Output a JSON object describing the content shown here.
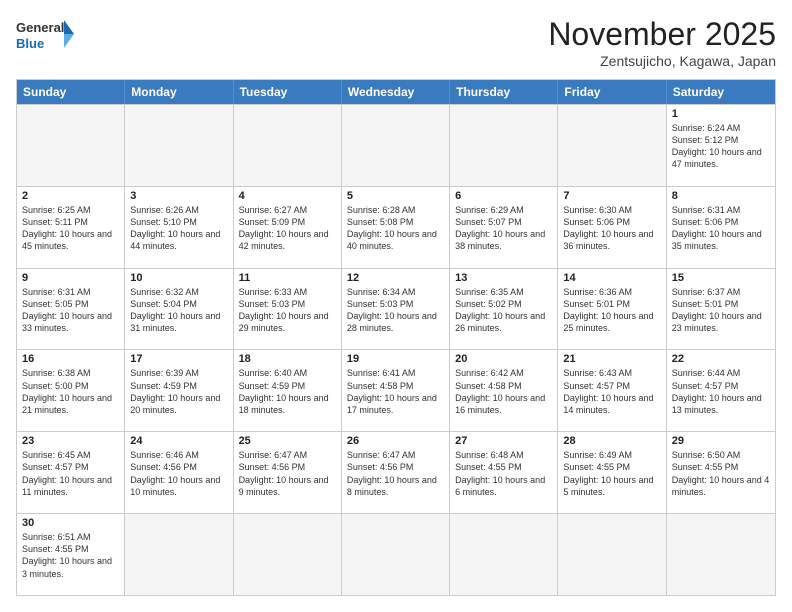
{
  "logo": {
    "line1": "General",
    "line2": "Blue"
  },
  "title": "November 2025",
  "location": "Zentsujicho, Kagawa, Japan",
  "weekdays": [
    "Sunday",
    "Monday",
    "Tuesday",
    "Wednesday",
    "Thursday",
    "Friday",
    "Saturday"
  ],
  "weeks": [
    [
      {
        "day": "",
        "info": ""
      },
      {
        "day": "",
        "info": ""
      },
      {
        "day": "",
        "info": ""
      },
      {
        "day": "",
        "info": ""
      },
      {
        "day": "",
        "info": ""
      },
      {
        "day": "",
        "info": ""
      },
      {
        "day": "1",
        "info": "Sunrise: 6:24 AM\nSunset: 5:12 PM\nDaylight: 10 hours and 47 minutes."
      }
    ],
    [
      {
        "day": "2",
        "info": "Sunrise: 6:25 AM\nSunset: 5:11 PM\nDaylight: 10 hours and 45 minutes."
      },
      {
        "day": "3",
        "info": "Sunrise: 6:26 AM\nSunset: 5:10 PM\nDaylight: 10 hours and 44 minutes."
      },
      {
        "day": "4",
        "info": "Sunrise: 6:27 AM\nSunset: 5:09 PM\nDaylight: 10 hours and 42 minutes."
      },
      {
        "day": "5",
        "info": "Sunrise: 6:28 AM\nSunset: 5:08 PM\nDaylight: 10 hours and 40 minutes."
      },
      {
        "day": "6",
        "info": "Sunrise: 6:29 AM\nSunset: 5:07 PM\nDaylight: 10 hours and 38 minutes."
      },
      {
        "day": "7",
        "info": "Sunrise: 6:30 AM\nSunset: 5:06 PM\nDaylight: 10 hours and 36 minutes."
      },
      {
        "day": "8",
        "info": "Sunrise: 6:31 AM\nSunset: 5:06 PM\nDaylight: 10 hours and 35 minutes."
      }
    ],
    [
      {
        "day": "9",
        "info": "Sunrise: 6:31 AM\nSunset: 5:05 PM\nDaylight: 10 hours and 33 minutes."
      },
      {
        "day": "10",
        "info": "Sunrise: 6:32 AM\nSunset: 5:04 PM\nDaylight: 10 hours and 31 minutes."
      },
      {
        "day": "11",
        "info": "Sunrise: 6:33 AM\nSunset: 5:03 PM\nDaylight: 10 hours and 29 minutes."
      },
      {
        "day": "12",
        "info": "Sunrise: 6:34 AM\nSunset: 5:03 PM\nDaylight: 10 hours and 28 minutes."
      },
      {
        "day": "13",
        "info": "Sunrise: 6:35 AM\nSunset: 5:02 PM\nDaylight: 10 hours and 26 minutes."
      },
      {
        "day": "14",
        "info": "Sunrise: 6:36 AM\nSunset: 5:01 PM\nDaylight: 10 hours and 25 minutes."
      },
      {
        "day": "15",
        "info": "Sunrise: 6:37 AM\nSunset: 5:01 PM\nDaylight: 10 hours and 23 minutes."
      }
    ],
    [
      {
        "day": "16",
        "info": "Sunrise: 6:38 AM\nSunset: 5:00 PM\nDaylight: 10 hours and 21 minutes."
      },
      {
        "day": "17",
        "info": "Sunrise: 6:39 AM\nSunset: 4:59 PM\nDaylight: 10 hours and 20 minutes."
      },
      {
        "day": "18",
        "info": "Sunrise: 6:40 AM\nSunset: 4:59 PM\nDaylight: 10 hours and 18 minutes."
      },
      {
        "day": "19",
        "info": "Sunrise: 6:41 AM\nSunset: 4:58 PM\nDaylight: 10 hours and 17 minutes."
      },
      {
        "day": "20",
        "info": "Sunrise: 6:42 AM\nSunset: 4:58 PM\nDaylight: 10 hours and 16 minutes."
      },
      {
        "day": "21",
        "info": "Sunrise: 6:43 AM\nSunset: 4:57 PM\nDaylight: 10 hours and 14 minutes."
      },
      {
        "day": "22",
        "info": "Sunrise: 6:44 AM\nSunset: 4:57 PM\nDaylight: 10 hours and 13 minutes."
      }
    ],
    [
      {
        "day": "23",
        "info": "Sunrise: 6:45 AM\nSunset: 4:57 PM\nDaylight: 10 hours and 11 minutes."
      },
      {
        "day": "24",
        "info": "Sunrise: 6:46 AM\nSunset: 4:56 PM\nDaylight: 10 hours and 10 minutes."
      },
      {
        "day": "25",
        "info": "Sunrise: 6:47 AM\nSunset: 4:56 PM\nDaylight: 10 hours and 9 minutes."
      },
      {
        "day": "26",
        "info": "Sunrise: 6:47 AM\nSunset: 4:56 PM\nDaylight: 10 hours and 8 minutes."
      },
      {
        "day": "27",
        "info": "Sunrise: 6:48 AM\nSunset: 4:55 PM\nDaylight: 10 hours and 6 minutes."
      },
      {
        "day": "28",
        "info": "Sunrise: 6:49 AM\nSunset: 4:55 PM\nDaylight: 10 hours and 5 minutes."
      },
      {
        "day": "29",
        "info": "Sunrise: 6:50 AM\nSunset: 4:55 PM\nDaylight: 10 hours and 4 minutes."
      }
    ],
    [
      {
        "day": "30",
        "info": "Sunrise: 6:51 AM\nSunset: 4:55 PM\nDaylight: 10 hours and 3 minutes."
      },
      {
        "day": "",
        "info": ""
      },
      {
        "day": "",
        "info": ""
      },
      {
        "day": "",
        "info": ""
      },
      {
        "day": "",
        "info": ""
      },
      {
        "day": "",
        "info": ""
      },
      {
        "day": "",
        "info": ""
      }
    ]
  ]
}
